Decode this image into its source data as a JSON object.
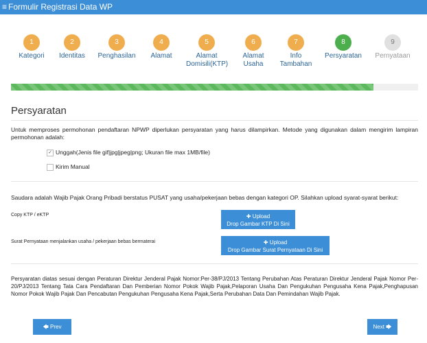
{
  "app": {
    "title": "Formulir Registrasi Data WP",
    "menu_icon": "≡"
  },
  "steps": [
    {
      "number": "1",
      "label": "Kategori",
      "state": "done"
    },
    {
      "number": "2",
      "label": "Identitas",
      "state": "done"
    },
    {
      "number": "3",
      "label": "Penghasilan",
      "state": "done"
    },
    {
      "number": "4",
      "label": "Alamat",
      "state": "done"
    },
    {
      "number": "5",
      "label": "Alamat Domisili(KTP)",
      "state": "done"
    },
    {
      "number": "6",
      "label": "Alamat Usaha",
      "state": "done"
    },
    {
      "number": "7",
      "label": "Info Tambahan",
      "state": "done"
    },
    {
      "number": "8",
      "label": "Persyaratan",
      "state": "active"
    },
    {
      "number": "9",
      "label": "Pernyataan",
      "state": "todo"
    }
  ],
  "progress_fraction": 0.89,
  "section": {
    "title": "Persyaratan",
    "intro": "Untuk memproses permohonan pendaftaran NPWP diperlukan persyaratan yang harus dilampirkan. Metode yang digunakan dalam mengirim lampiran permohonan adalah:",
    "options": [
      {
        "label": "Unggah(Jenis file gif|jpg|jpeg|png; Ukuran file max 1MB/file)",
        "checked": true
      },
      {
        "label": "Kirim Manual",
        "checked": false
      }
    ],
    "note": "Saudara adalah Wajib Pajak Orang Pribadi berstatus PUSAT yang usaha/pekerjaan bebas dengan kategori OP. Silahkan upload syarat-syarat berikut:",
    "documents": [
      {
        "label": "Copy KTP / eKTP",
        "upload_label": "✚ Upload",
        "drop_label": "Drop Gambar KTP Di Sini"
      },
      {
        "label": "Surat Pernyataan menjalankan usaha / pekerjaan bebas bermaterai",
        "upload_label": "✚ Upload",
        "drop_label": "Drop Gambar Surat Pernyataan Di Sini"
      }
    ],
    "footer": "Persyaratan diatas sesuai dengan Peraturan Direktur Jenderal Pajak Nomor:Per-38/PJ/2013 Tentang Perubahan Atas Peraturan Direktur Jenderal Pajak Nomor Per-20/PJ/2013 Tentang Tata Cara Pendaftaran Dan Pemberian Nomor Pokok Wajib Pajak,Pelaporan Usaha Dan Pengukuhan Pengusaha Kena Pajak,Penghapusan Nomor Pokok Wajib Pajak Dan Pencabutan Pengukuhan Pengusaha Kena Pajak,Serta Perubahan Data Dan Pemindahan Wajib Pajak."
  },
  "nav": {
    "prev": "🡄 Prev",
    "next": "Next 🡆"
  },
  "colors": {
    "primary": "#3c8ed6",
    "step_done": "#f0ad4e",
    "step_active": "#4cae4c",
    "progress": "#5cb85c"
  }
}
